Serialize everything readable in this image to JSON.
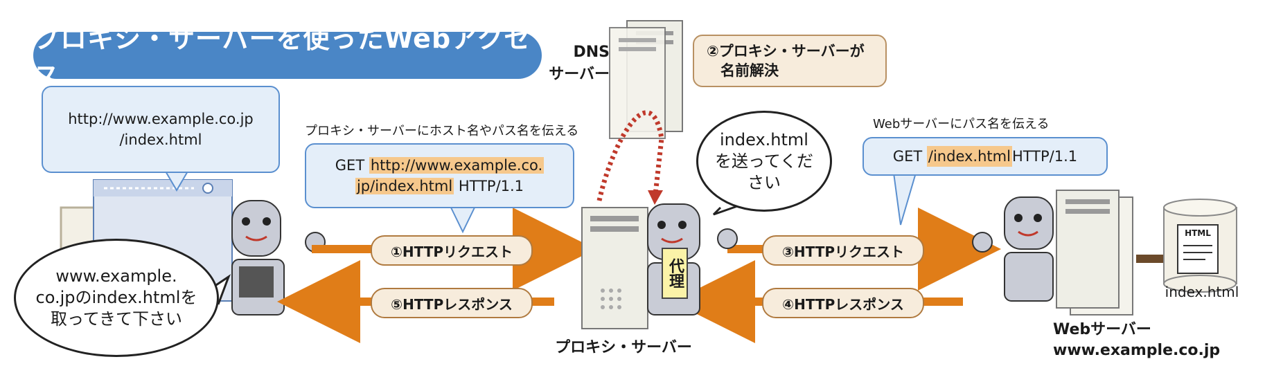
{
  "title": "プロキシ・サーバーを使ったWebアクセス",
  "browser_bubble": {
    "line1": "http://www.example.co.jp",
    "line2": "/index.html"
  },
  "step1_caption": "プロキシ・サーバーにホスト名やパス名を伝える",
  "request1": {
    "prefix": "GET ",
    "url_a": "http://www.example.co.",
    "url_b": "jp/index.html",
    "suffix": " HTTP/1.1"
  },
  "dns": {
    "line1": "DNS",
    "line2": "サーバー"
  },
  "step2_note": {
    "line1": "②プロキシ・サーバーが",
    "line2": "名前解決"
  },
  "proxy_bubble": {
    "line1": "index.html",
    "line2": "を送ってくだ",
    "line3": "さい"
  },
  "step3_caption": "Webサーバーにパス名を伝える",
  "request2": {
    "prefix": "GET ",
    "path": "/index.html",
    "suffix": " HTTP/1.1"
  },
  "client_bubble": {
    "line1": "www.example.",
    "line2": "co.jpのindex.htmlを",
    "line3": "取ってきて下さい"
  },
  "arrows": {
    "a1": "①HTTPリクエスト",
    "a5": "⑤HTTPレスポンス",
    "a3": "③HTTPリクエスト",
    "a4": "④HTTPレスポンス"
  },
  "proxy_label": "プロキシ・サーバー",
  "proxy_tag": "代理",
  "file": {
    "doc_label": "HTML",
    "name": "index.html"
  },
  "web_server": {
    "line1": "Webサーバー",
    "line2": "www.example.co.jp"
  },
  "colors": {
    "arrow": "#e07d18",
    "title": "#4a86c6",
    "bubble_border": "#5a8fcf",
    "highlight": "#f6c88c"
  }
}
